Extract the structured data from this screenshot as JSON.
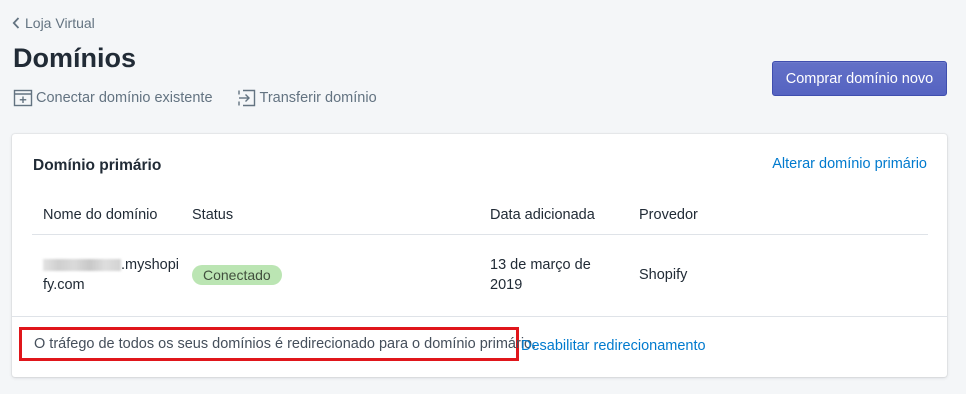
{
  "breadcrumb": {
    "label": "Loja Virtual",
    "icon": "chevron-left-icon"
  },
  "page": {
    "title": "Domínios"
  },
  "actions": {
    "connect_label": "Conectar domínio existente",
    "connect_icon": "browser-add-icon",
    "transfer_label": "Transferir domínio",
    "transfer_icon": "transfer-icon"
  },
  "buy_button": {
    "label": "Comprar domínio novo",
    "color": "#5c6ac4"
  },
  "card": {
    "title": "Domínio primário",
    "change_link": "Alterar domínio primário",
    "table": {
      "headers": [
        "Nome do domínio",
        "Status",
        "Data adicionada",
        "Provedor"
      ],
      "rows": [
        {
          "domain_suffix": ".myshopi",
          "domain_suffix_2": "fy.com",
          "status": "Conectado",
          "date_line1": "13 de março de",
          "date_line2": "2019",
          "provider": "Shopify"
        }
      ]
    },
    "footer_note": "O tráfego de todos os seus domínios é redirecionado para o domínio primário.",
    "footer_link": "Desabilitar redirecionamento"
  },
  "colors": {
    "accent": "#5c6ac4",
    "link": "#007ace",
    "badge_success": "#bbe5b3",
    "highlight_border": "#e0161b"
  }
}
